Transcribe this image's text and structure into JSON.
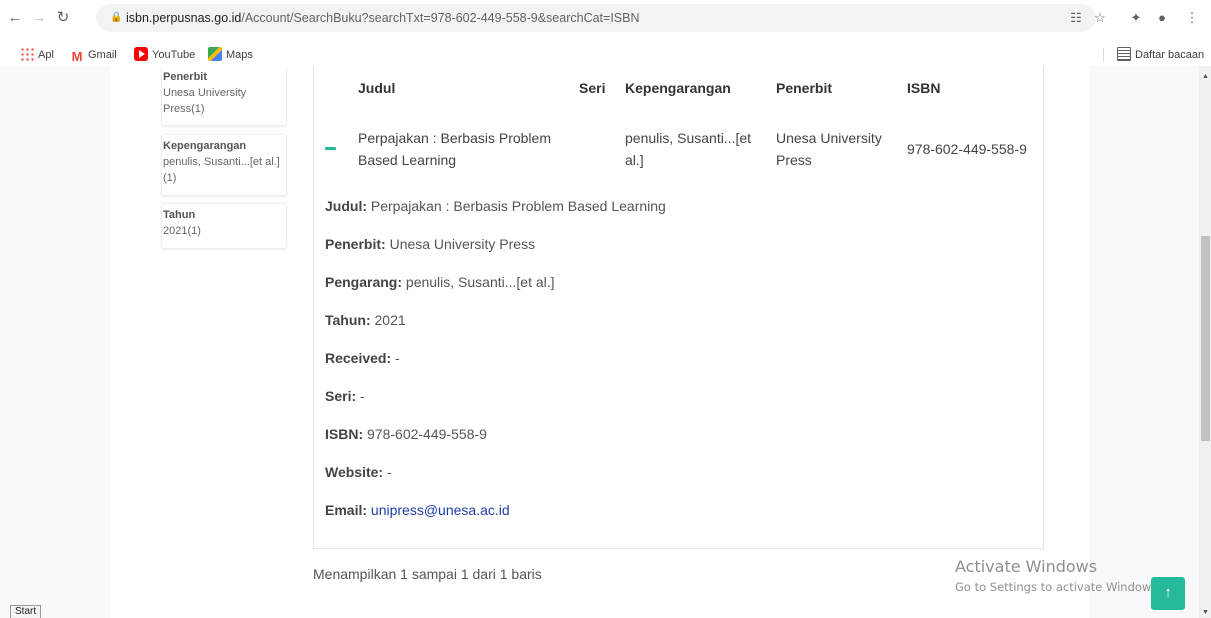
{
  "browser": {
    "url_host": "isbn.perpusnas.go.id",
    "url_path": "/Account/SearchBuku?searchTxt=978-602-449-558-9&searchCat=ISBN",
    "back_icon": "arrow-left-icon",
    "forward_icon": "arrow-right-icon",
    "reload_icon": "reload-icon"
  },
  "bookmarks": {
    "apps": "Apl",
    "gmail": "Gmail",
    "youtube": "YouTube",
    "maps": "Maps",
    "reading_list": "Daftar bacaan"
  },
  "facets": [
    {
      "title": "Penerbit",
      "value": "Unesa University Press(1)"
    },
    {
      "title": "Kepengarangan",
      "value": "penulis, Susanti...[et al.](1)"
    },
    {
      "title": "Tahun",
      "value": "2021(1)"
    }
  ],
  "table": {
    "headers": {
      "judul": "Judul",
      "seri": "Seri",
      "kepengarangan": "Kepengarangan",
      "penerbit": "Penerbit",
      "isbn": "ISBN"
    },
    "row": {
      "judul": "Perpajakan : Berbasis Problem Based Learning",
      "seri": "",
      "kepengarangan": "penulis, Susanti...[et al.]",
      "penerbit": "Unesa University Press",
      "isbn": "978-602-449-558-9"
    }
  },
  "details": [
    {
      "label": "Judul:",
      "value": "Perpajakan : Berbasis Problem Based Learning"
    },
    {
      "label": "Penerbit:",
      "value": "Unesa University Press"
    },
    {
      "label": "Pengarang:",
      "value": "penulis, Susanti...[et al.]"
    },
    {
      "label": "Tahun:",
      "value": "2021"
    },
    {
      "label": "Received:",
      "value": "-"
    },
    {
      "label": "Seri:",
      "value": "-"
    },
    {
      "label": "ISBN:",
      "value": "978-602-449-558-9"
    },
    {
      "label": "Website:",
      "value": "-"
    },
    {
      "label": "Email:",
      "value": "unipress@unesa.ac.id"
    }
  ],
  "pager_text": "Menampilkan 1 sampai 1 dari 1 baris",
  "watermark": {
    "line1": "Activate Windows",
    "line2": "Go to Settings to activate Windows."
  },
  "start_label": "Start",
  "colors": {
    "accent": "#26b99a",
    "link": "#1a3ea8"
  }
}
